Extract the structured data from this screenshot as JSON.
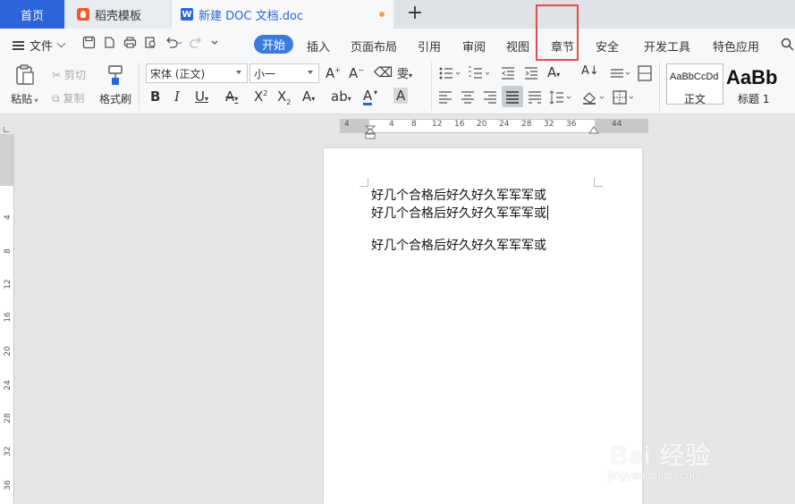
{
  "tabs": {
    "home": "首页",
    "template": "稻壳模板",
    "document": "新建 DOC 文档.doc",
    "new_tab_symbol": "+"
  },
  "menu": {
    "file": "文件",
    "items": [
      "开始",
      "插入",
      "页面布局",
      "引用",
      "审阅",
      "视图",
      "章节",
      "安全",
      "开发工具",
      "特色应用"
    ],
    "active": "开始",
    "highlighted": "章节"
  },
  "ribbon": {
    "paste": "粘贴",
    "cut": "剪切",
    "copy": "复制",
    "format_painter": "格式刷",
    "font_name": "宋体 (正文)",
    "font_size": "小一",
    "styles": [
      {
        "sample": "AaBbCcDd",
        "name": "正文"
      },
      {
        "sample": "AaBb",
        "name": "标题 1"
      }
    ]
  },
  "ruler": {
    "horizontal_ticks": [
      "4",
      "4",
      "8",
      "12",
      "16",
      "20",
      "24",
      "28",
      "32",
      "36",
      "44"
    ],
    "vertical_ticks": [
      "4",
      "8",
      "12",
      "16",
      "20",
      "24",
      "28",
      "32",
      "36"
    ]
  },
  "document": {
    "lines": [
      "好几个合格后好久好久军军军或",
      "好几个合格后好久好久军军军或",
      "",
      "好几个合格后好久好久军军军或"
    ]
  },
  "watermark": {
    "brand": "Bai 经验",
    "url": "jingyan.baidu.com"
  },
  "colors": {
    "accent": "#2b65d9",
    "highlight_box": "#e64b4b",
    "active_menu": "#3a7be0"
  }
}
